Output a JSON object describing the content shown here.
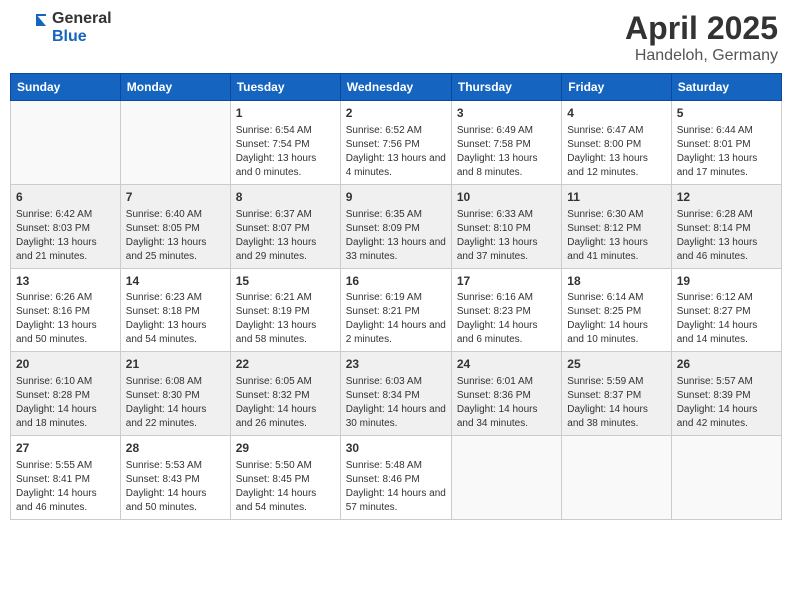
{
  "header": {
    "logo_general": "General",
    "logo_blue": "Blue",
    "month": "April 2025",
    "location": "Handeloh, Germany"
  },
  "weekdays": [
    "Sunday",
    "Monday",
    "Tuesday",
    "Wednesday",
    "Thursday",
    "Friday",
    "Saturday"
  ],
  "weeks": [
    [
      {
        "day": "",
        "info": ""
      },
      {
        "day": "",
        "info": ""
      },
      {
        "day": "1",
        "info": "Sunrise: 6:54 AM\nSunset: 7:54 PM\nDaylight: 13 hours and 0 minutes."
      },
      {
        "day": "2",
        "info": "Sunrise: 6:52 AM\nSunset: 7:56 PM\nDaylight: 13 hours and 4 minutes."
      },
      {
        "day": "3",
        "info": "Sunrise: 6:49 AM\nSunset: 7:58 PM\nDaylight: 13 hours and 8 minutes."
      },
      {
        "day": "4",
        "info": "Sunrise: 6:47 AM\nSunset: 8:00 PM\nDaylight: 13 hours and 12 minutes."
      },
      {
        "day": "5",
        "info": "Sunrise: 6:44 AM\nSunset: 8:01 PM\nDaylight: 13 hours and 17 minutes."
      }
    ],
    [
      {
        "day": "6",
        "info": "Sunrise: 6:42 AM\nSunset: 8:03 PM\nDaylight: 13 hours and 21 minutes."
      },
      {
        "day": "7",
        "info": "Sunrise: 6:40 AM\nSunset: 8:05 PM\nDaylight: 13 hours and 25 minutes."
      },
      {
        "day": "8",
        "info": "Sunrise: 6:37 AM\nSunset: 8:07 PM\nDaylight: 13 hours and 29 minutes."
      },
      {
        "day": "9",
        "info": "Sunrise: 6:35 AM\nSunset: 8:09 PM\nDaylight: 13 hours and 33 minutes."
      },
      {
        "day": "10",
        "info": "Sunrise: 6:33 AM\nSunset: 8:10 PM\nDaylight: 13 hours and 37 minutes."
      },
      {
        "day": "11",
        "info": "Sunrise: 6:30 AM\nSunset: 8:12 PM\nDaylight: 13 hours and 41 minutes."
      },
      {
        "day": "12",
        "info": "Sunrise: 6:28 AM\nSunset: 8:14 PM\nDaylight: 13 hours and 46 minutes."
      }
    ],
    [
      {
        "day": "13",
        "info": "Sunrise: 6:26 AM\nSunset: 8:16 PM\nDaylight: 13 hours and 50 minutes."
      },
      {
        "day": "14",
        "info": "Sunrise: 6:23 AM\nSunset: 8:18 PM\nDaylight: 13 hours and 54 minutes."
      },
      {
        "day": "15",
        "info": "Sunrise: 6:21 AM\nSunset: 8:19 PM\nDaylight: 13 hours and 58 minutes."
      },
      {
        "day": "16",
        "info": "Sunrise: 6:19 AM\nSunset: 8:21 PM\nDaylight: 14 hours and 2 minutes."
      },
      {
        "day": "17",
        "info": "Sunrise: 6:16 AM\nSunset: 8:23 PM\nDaylight: 14 hours and 6 minutes."
      },
      {
        "day": "18",
        "info": "Sunrise: 6:14 AM\nSunset: 8:25 PM\nDaylight: 14 hours and 10 minutes."
      },
      {
        "day": "19",
        "info": "Sunrise: 6:12 AM\nSunset: 8:27 PM\nDaylight: 14 hours and 14 minutes."
      }
    ],
    [
      {
        "day": "20",
        "info": "Sunrise: 6:10 AM\nSunset: 8:28 PM\nDaylight: 14 hours and 18 minutes."
      },
      {
        "day": "21",
        "info": "Sunrise: 6:08 AM\nSunset: 8:30 PM\nDaylight: 14 hours and 22 minutes."
      },
      {
        "day": "22",
        "info": "Sunrise: 6:05 AM\nSunset: 8:32 PM\nDaylight: 14 hours and 26 minutes."
      },
      {
        "day": "23",
        "info": "Sunrise: 6:03 AM\nSunset: 8:34 PM\nDaylight: 14 hours and 30 minutes."
      },
      {
        "day": "24",
        "info": "Sunrise: 6:01 AM\nSunset: 8:36 PM\nDaylight: 14 hours and 34 minutes."
      },
      {
        "day": "25",
        "info": "Sunrise: 5:59 AM\nSunset: 8:37 PM\nDaylight: 14 hours and 38 minutes."
      },
      {
        "day": "26",
        "info": "Sunrise: 5:57 AM\nSunset: 8:39 PM\nDaylight: 14 hours and 42 minutes."
      }
    ],
    [
      {
        "day": "27",
        "info": "Sunrise: 5:55 AM\nSunset: 8:41 PM\nDaylight: 14 hours and 46 minutes."
      },
      {
        "day": "28",
        "info": "Sunrise: 5:53 AM\nSunset: 8:43 PM\nDaylight: 14 hours and 50 minutes."
      },
      {
        "day": "29",
        "info": "Sunrise: 5:50 AM\nSunset: 8:45 PM\nDaylight: 14 hours and 54 minutes."
      },
      {
        "day": "30",
        "info": "Sunrise: 5:48 AM\nSunset: 8:46 PM\nDaylight: 14 hours and 57 minutes."
      },
      {
        "day": "",
        "info": ""
      },
      {
        "day": "",
        "info": ""
      },
      {
        "day": "",
        "info": ""
      }
    ]
  ]
}
